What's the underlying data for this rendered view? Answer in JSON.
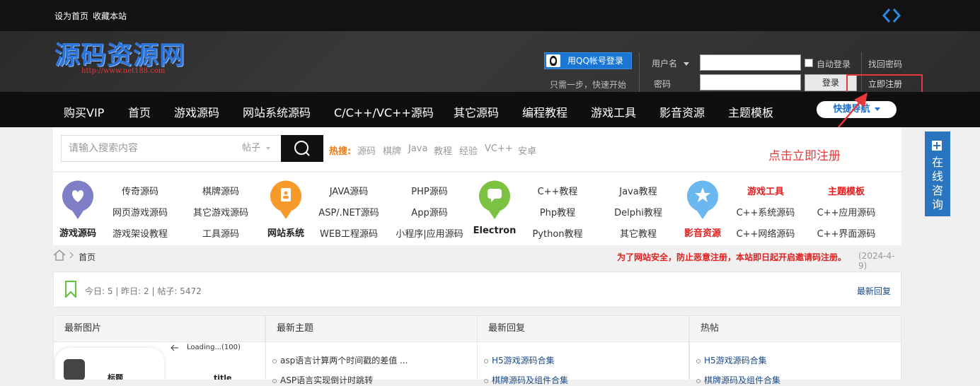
{
  "topbar": {
    "set_home": "设为首页",
    "bookmark": "收藏本站"
  },
  "header": {
    "logo_text": "源码资源网",
    "logo_url": "http://www.net188.com",
    "qq_login": "用QQ帐号登录",
    "qq_tip": "只需一步，快速开始",
    "username_label": "用户名",
    "password_label": "密码",
    "remember_label": "自动登录",
    "find_password": "找回密码",
    "login_button": "登录",
    "register": "立即注册"
  },
  "nav": {
    "items": [
      "购买VIP",
      "首页",
      "游戏源码",
      "网站系统源码",
      "C/C++/VC++源码",
      "其它源码",
      "编程教程",
      "游戏工具",
      "影音资源",
      "主题模板"
    ],
    "quick_nav": "快捷导航"
  },
  "annotation": "点击立即注册",
  "search": {
    "placeholder": "请输入搜索内容",
    "type": "帖子",
    "hot_label": "热搜:",
    "hot_words": [
      "源码",
      "棋牌",
      "Java",
      "教程",
      "经验",
      "VC++",
      "安卓"
    ]
  },
  "categories": {
    "groups": [
      {
        "name": "游戏源码",
        "color": "#7f7fc7",
        "icon": "heart-icon",
        "links": [
          "传奇源码",
          "棋牌源码",
          "网页游戏源码",
          "其它游戏源码",
          "游戏架设教程",
          "工具源码"
        ]
      },
      {
        "name": "网站系统",
        "color": "#f59a2b",
        "icon": "address-book-icon",
        "links": [
          "JAVA源码",
          "PHP源码",
          "ASP/.NET源码",
          "App源码",
          "WEB工程源码",
          "小程序|应用源码"
        ]
      },
      {
        "name": "Electron",
        "color": "#7bc142",
        "icon": "chat-icon",
        "links": [
          "C++教程",
          "Java教程",
          "Php教程",
          "Delphi教程",
          "Python教程",
          "其它教程"
        ]
      },
      {
        "name": "影音资源",
        "color": "#6bb7f0",
        "icon": "star-icon",
        "links": [
          "游戏工具",
          "主题模板",
          "C++系统源码",
          "C++应用源码",
          "C++网络源码",
          "C++界面源码"
        ]
      }
    ]
  },
  "breadcrumb": {
    "home": "首页",
    "notice": "为了网站安全，防止恶意注册，本站即日起开启邀请码注册。",
    "notice_date": "(2024-4-9)"
  },
  "stats": {
    "text": "今日: 5 | 昨日: 2 | 帖子: 5472",
    "latest_reply": "最新回复"
  },
  "columns": [
    {
      "title": "最新图片",
      "items": []
    },
    {
      "title": "最新主题",
      "items": [
        "asp语言计算两个时间戳的差值 ...",
        "ASP语言实现倒计时跳转"
      ]
    },
    {
      "title": "最新回复",
      "items": [
        "H5游戏源码合集",
        "棋牌源码及组件合集"
      ]
    },
    {
      "title": "热帖",
      "items": [
        "H5游戏源码合集",
        "棋牌源码及组件合集"
      ]
    }
  ],
  "thumbnail": {
    "title": "标题",
    "loading": "Loading...(100)",
    "subtitle": "title"
  },
  "side_panel": {
    "text": "在线咨询"
  }
}
